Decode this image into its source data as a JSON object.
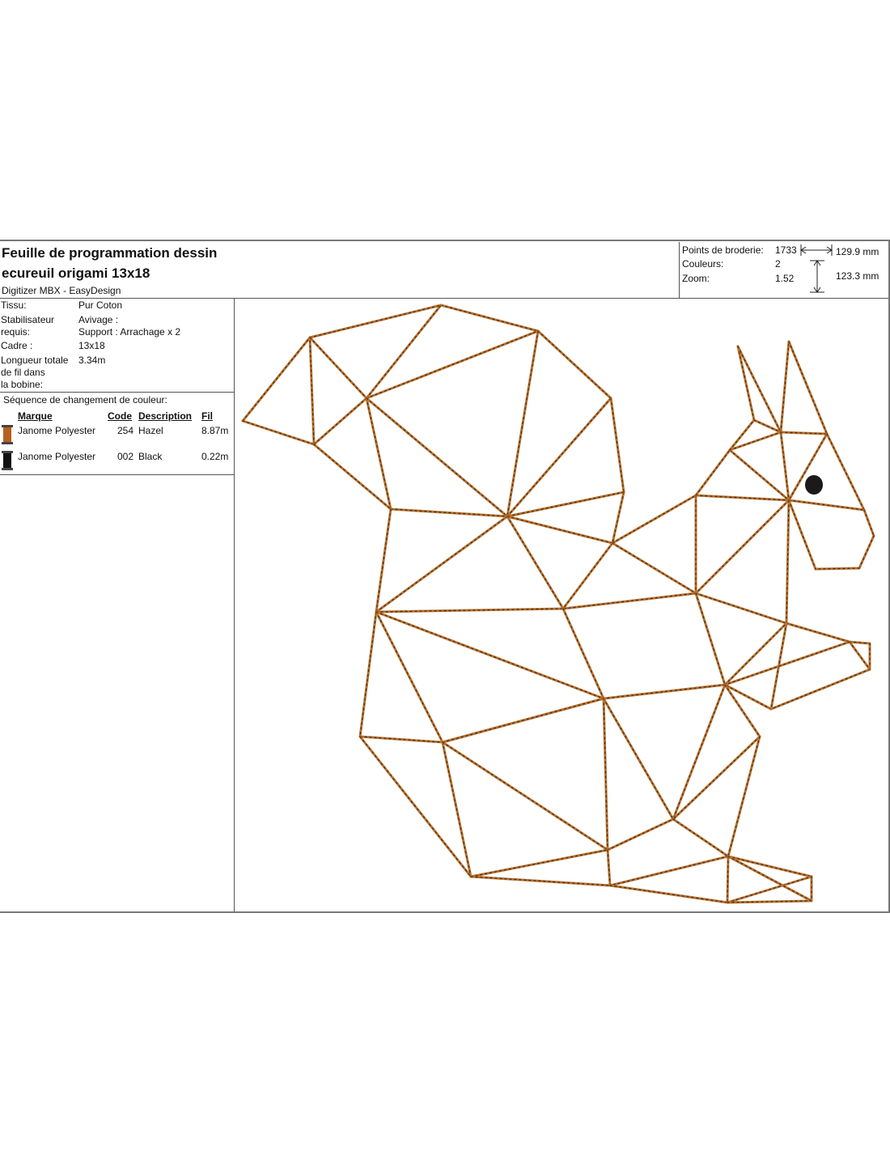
{
  "header": {
    "title_line1": "Feuille de programmation dessin",
    "title_line2": "ecureuil origami 13x18",
    "software": "Digitizer MBX - EasyDesign"
  },
  "stats": {
    "points_label": "Points de broderie:",
    "points_value": "1733",
    "colors_label": "Couleurs:",
    "colors_value": "2",
    "zoom_label": "Zoom:",
    "zoom_value": "1.52",
    "width_value": "129.9 mm",
    "height_value": "123.3 mm"
  },
  "fabric": {
    "tissu_label": "Tissu:",
    "tissu_value": "Pur Coton",
    "stab_label_1": "Stabilisateur",
    "stab_label_2": "requis:",
    "stab_value_1": "Avivage :",
    "stab_value_2": "Support : Arrachage x 2",
    "cadre_label": "Cadre :",
    "cadre_value": "13x18",
    "longueur_label_1": "Longueur totale",
    "longueur_label_2": "de fil dans",
    "longueur_label_3": "la bobine:",
    "longueur_value": "3.34m"
  },
  "color_sequence": {
    "title": "Séquence de changement de couleur:",
    "headers": {
      "brand": "Marque",
      "code": "Code",
      "description": "Description",
      "thread": "Fil"
    },
    "rows": [
      {
        "brand": "Janome Polyester",
        "code": "254",
        "description": "Hazel",
        "thread": "8.87m",
        "color": "#b5611f"
      },
      {
        "brand": "Janome Polyester",
        "code": "002",
        "description": "Black",
        "thread": "0.22m",
        "color": "#111111"
      }
    ]
  },
  "colors": {
    "stitch": "#b87333",
    "stitch_dark": "#5a3512",
    "eye": "#1a1a1a"
  }
}
